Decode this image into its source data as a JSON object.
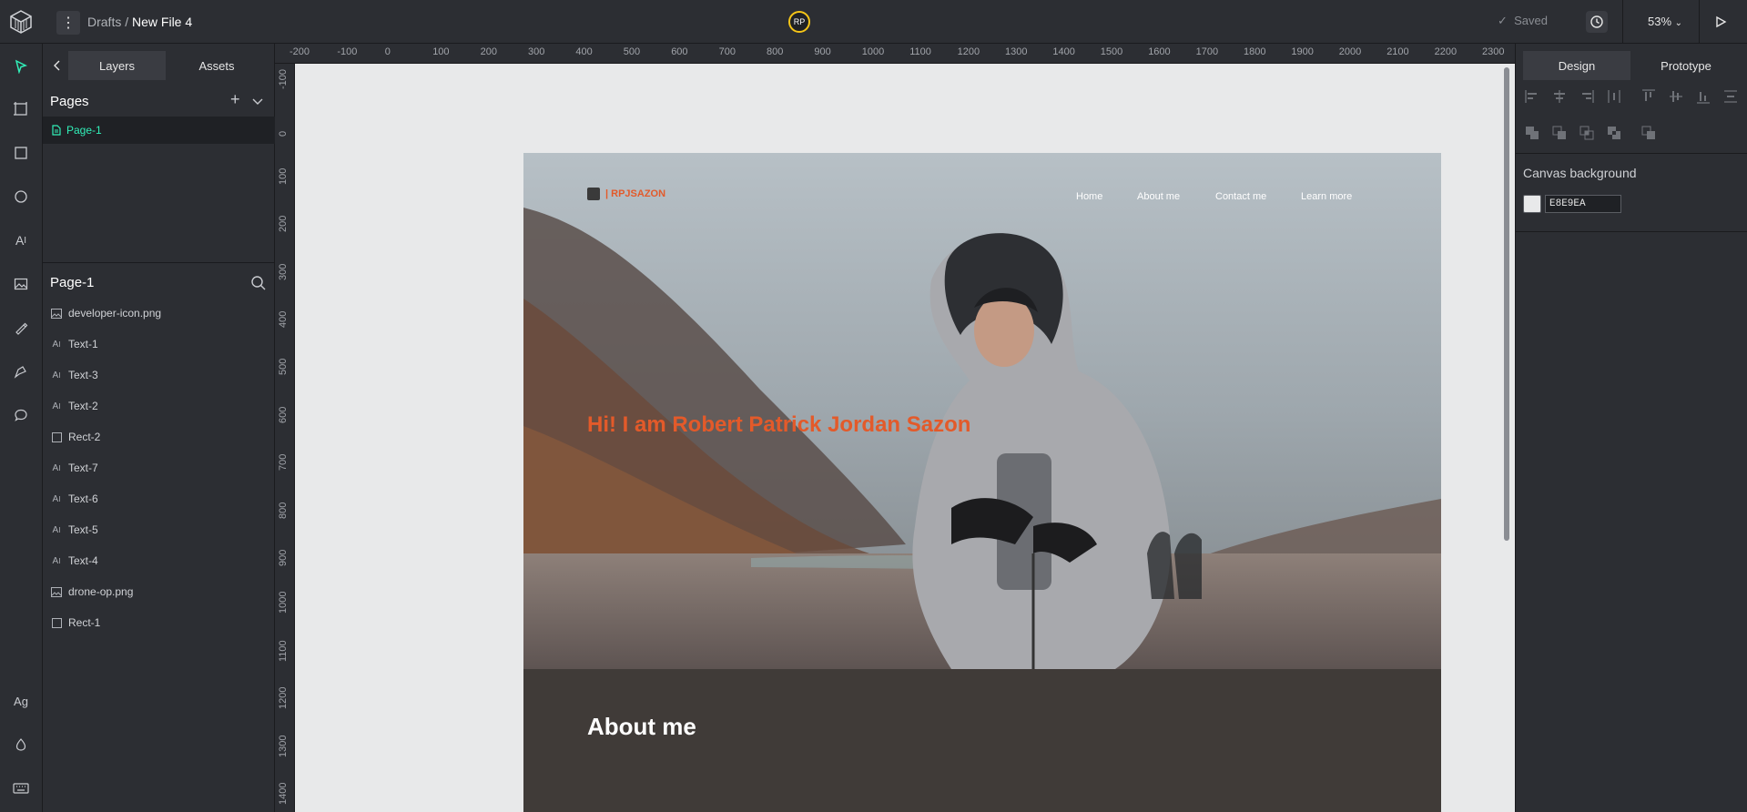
{
  "topbar": {
    "breadcrumb_parent": "Drafts",
    "breadcrumb_sep": " / ",
    "file_name": "New File 4",
    "avatar_initials": "RP",
    "saved_label": "Saved",
    "zoom_label": "53%"
  },
  "left_panel": {
    "tab_layers": "Layers",
    "tab_assets": "Assets",
    "pages_title": "Pages",
    "pages": [
      "Page-1"
    ],
    "current_page_title": "Page-1",
    "layers": [
      {
        "name": "developer-icon.png",
        "type": "image"
      },
      {
        "name": "Text-1",
        "type": "text"
      },
      {
        "name": "Text-3",
        "type": "text"
      },
      {
        "name": "Text-2",
        "type": "text"
      },
      {
        "name": "Rect-2",
        "type": "rect"
      },
      {
        "name": "Text-7",
        "type": "text"
      },
      {
        "name": "Text-6",
        "type": "text"
      },
      {
        "name": "Text-5",
        "type": "text"
      },
      {
        "name": "Text-4",
        "type": "text"
      },
      {
        "name": "drone-op.png",
        "type": "image"
      },
      {
        "name": "Rect-1",
        "type": "rect"
      }
    ]
  },
  "rulers": {
    "top": [
      "-200",
      "-100",
      "0",
      "100",
      "200",
      "300",
      "400",
      "500",
      "600",
      "700",
      "800",
      "900",
      "1000",
      "1100",
      "1200",
      "1300",
      "1400",
      "1500",
      "1600",
      "1700",
      "1800",
      "1900",
      "2000",
      "2100",
      "2200",
      "2300"
    ],
    "left": [
      "-100",
      "0",
      "100",
      "200",
      "300",
      "400",
      "500",
      "600",
      "700",
      "800",
      "900",
      "1000",
      "1100",
      "1200",
      "1300",
      "1400"
    ]
  },
  "site": {
    "logo_text": "| RPJSAZON",
    "nav": [
      "Home",
      "About me",
      "Contact me",
      "Learn more"
    ],
    "hero_title": "Hi! I am Robert Patrick Jordan Sazon",
    "about_title": "About me"
  },
  "right_panel": {
    "tab_design": "Design",
    "tab_prototype": "Prototype",
    "canvas_bg_title": "Canvas background",
    "canvas_bg_hex": "E8E9EA"
  },
  "colors": {
    "accent": "#31efb8",
    "brand_orange": "#e35a2a",
    "canvas_bg": "#e8e9ea"
  }
}
